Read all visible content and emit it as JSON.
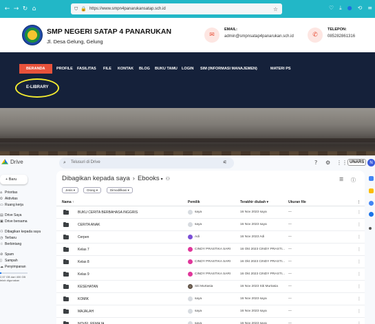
{
  "browser": {
    "back": "←",
    "forward": "→",
    "reload": "↻",
    "home": "⌂",
    "url": "https://www.smpn4panarukansatap.sch.id",
    "icons": [
      "shield-icon",
      "lock-icon",
      "star-icon",
      "pocket-icon",
      "download-icon",
      "extension-icon",
      "history-icon",
      "menu-icon"
    ]
  },
  "school": {
    "name": "SMP NEGERI SATAP 4 PANARUKAN",
    "address": "Jl. Desa Gelung, Gelung",
    "email_label": "EMAIL:",
    "email_value": "admin@smpnsatap4panarukan.sch.id",
    "phone_label": "TELEPON:",
    "phone_value": "085282861316",
    "colors": {
      "accent": "#e8523b",
      "nav_bg": "#15213a",
      "browser": "#22b7c7"
    }
  },
  "site_nav": {
    "items": [
      "BERANDA",
      "PROFILE",
      "FASILITAS",
      "FILE",
      "KONTAK",
      "BLOG",
      "BUKU TAMU",
      "LOGIN",
      "SIM (INFORMASI MANAJEMEN)",
      "MATERI PS"
    ],
    "active": "BERANDA",
    "submenu": "E-LIBRARY"
  },
  "drive": {
    "title": "Drive",
    "search_placeholder": "Telusuri di Drive",
    "badge": "UNARS",
    "avatar_initial": "N",
    "new_label": "Baru",
    "sidebar": [
      {
        "icon": "home-icon",
        "label": "Prioritas"
      },
      {
        "icon": "activity-icon",
        "label": "Aktivitas"
      },
      {
        "icon": "workspace-icon",
        "label": "Ruang kerja"
      },
      {
        "icon": "drive-icon",
        "label": "Drive Saya"
      },
      {
        "icon": "shared-drive-icon",
        "label": "Drive bersama"
      },
      {
        "icon": "people-icon",
        "label": "Dibagikan kepada saya"
      },
      {
        "icon": "clock-icon",
        "label": "Terbaru"
      },
      {
        "icon": "star-icon",
        "label": "Berbintang"
      },
      {
        "icon": "spam-icon",
        "label": "Spam"
      },
      {
        "icon": "trash-icon",
        "label": "Sampah"
      },
      {
        "icon": "cloud-icon",
        "label": "Penyimpanan"
      }
    ],
    "storage_text": "2,57 GB dari 400 GB telah digunakan",
    "storage_fraction": 0.0064,
    "breadcrumb": [
      "Dibagikan kepada saya",
      "Ebooks"
    ],
    "filters": [
      "Jenis",
      "Orang",
      "Dimodifikasi"
    ],
    "columns": {
      "name": "Nama",
      "owner": "Pemilik",
      "modified": "Terakhir diubah",
      "size": "Ukuran file"
    },
    "rows": [
      {
        "name": "BUKU CERITA BERBAHASA INGGRIS",
        "owner": "saya",
        "avatar": "default",
        "modified": "16 Nov 2023 saya",
        "size": "—"
      },
      {
        "name": "CERITA ANAK",
        "owner": "saya",
        "avatar": "default",
        "modified": "16 Nov 2023 saya",
        "size": "—"
      },
      {
        "name": "Cerpen",
        "owner": "Adi",
        "avatar": "purple",
        "modified": "16 Nov 2023 Adi",
        "size": "—"
      },
      {
        "name": "Kelas 7",
        "owner": "CINDY PRASTIKA SARI",
        "avatar": "pink",
        "modified": "16 Okt 2023 CINDY PRASTI...",
        "size": "—"
      },
      {
        "name": "Kelas 8",
        "owner": "CINDY PRASTIKA SARI",
        "avatar": "pink",
        "modified": "16 Okt 2023 CINDY PRASTI...",
        "size": "—"
      },
      {
        "name": "Kelas 9",
        "owner": "CINDY PRASTIKA SARI",
        "avatar": "pink",
        "modified": "16 Okt 2023 CINDY PRASTI...",
        "size": "—"
      },
      {
        "name": "KESEHATAN",
        "owner": "Siti Murtasia",
        "avatar": "photo",
        "modified": "16 Nov 2023 Siti Murtasia",
        "size": "—"
      },
      {
        "name": "KOMIK",
        "owner": "saya",
        "avatar": "default",
        "modified": "16 Nov 2023 saya",
        "size": "—"
      },
      {
        "name": "MAJALAH",
        "owner": "saya",
        "avatar": "default",
        "modified": "16 Nov 2023 saya",
        "size": "—"
      },
      {
        "name": "NOVEL REMAJA",
        "owner": "saya",
        "avatar": "default",
        "modified": "16 Nov 2023 saya",
        "size": "—"
      }
    ]
  }
}
